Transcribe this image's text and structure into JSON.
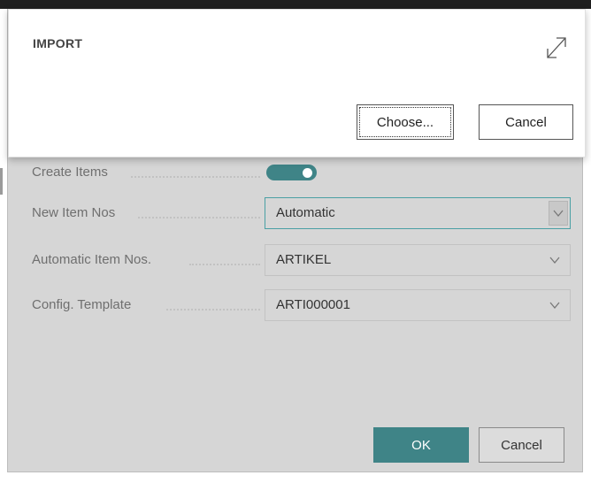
{
  "import_dialog": {
    "title": "IMPORT",
    "expand_icon": "expand-diagonal-icon",
    "choose_label": "Choose...",
    "cancel_label": "Cancel"
  },
  "form": {
    "create_items": {
      "label": "Create Items",
      "value": true
    },
    "new_item_nos": {
      "label": "New Item Nos",
      "value": "Automatic"
    },
    "automatic_item_nos": {
      "label": "Automatic Item Nos.",
      "value": "ARTIKEL"
    },
    "config_template": {
      "label": "Config. Template",
      "value": "ARTI000001"
    }
  },
  "footer": {
    "ok_label": "OK",
    "cancel_label": "Cancel"
  },
  "colors": {
    "accent": "#3f8487",
    "focus_border": "#4aa0a4",
    "dim_background": "#d6d6d6"
  }
}
